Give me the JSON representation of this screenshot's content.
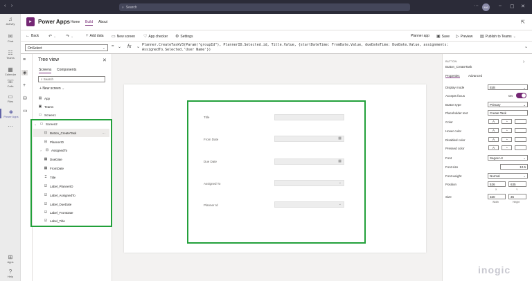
{
  "titlebar": {
    "search_placeholder": "Search",
    "avatar_initials": "MA"
  },
  "rail": [
    {
      "label": "Activity",
      "icon": "bell-icon"
    },
    {
      "label": "Chat",
      "icon": "chat-icon"
    },
    {
      "label": "Teams",
      "icon": "teams-icon"
    },
    {
      "label": "Calendar",
      "icon": "calendar-icon"
    },
    {
      "label": "Calls",
      "icon": "phone-icon"
    },
    {
      "label": "Files",
      "icon": "file-icon"
    },
    {
      "label": "Power Apps",
      "icon": "powerapps-icon"
    },
    {
      "label": "Apps",
      "icon": "apps-icon"
    },
    {
      "label": "Help",
      "icon": "help-icon"
    }
  ],
  "header": {
    "app_name": "Power Apps",
    "tabs": [
      "Home",
      "Build",
      "About"
    ],
    "active_tab": "Build"
  },
  "commands": {
    "back": "Back",
    "add_data": "Add data",
    "new_screen": "New screen",
    "app_checker": "App checker",
    "settings": "Settings",
    "planner_app": "Planner app",
    "save": "Save",
    "preview": "Preview",
    "publish": "Publish to Teams"
  },
  "formula_bar": {
    "property": "OnSelect",
    "fx": "fx",
    "line1": "Planner.CreateTaskV3(Param(\"groupId\"), PlannerID.Selected.id, Title.Value, {startDateTime: FromDate.Value, dueDateTime: DueDate.Value, assignments:",
    "line2": "AssignedTo.Selected.'User Name'})"
  },
  "tree": {
    "title": "Tree view",
    "tabs": [
      "Screens",
      "Components"
    ],
    "search_placeholder": "Search",
    "new_screen": "New screen",
    "nodes": [
      {
        "label": "App",
        "icon": "app-icon"
      },
      {
        "label": "Teams",
        "icon": "teams-icon"
      },
      {
        "label": "Screen1",
        "icon": "screen-icon"
      },
      {
        "label": "Screen2",
        "icon": "screen-icon"
      },
      {
        "label": "Button_CreateTask",
        "icon": "button-icon"
      },
      {
        "label": "PlannerID",
        "icon": "dropdown-icon"
      },
      {
        "label": "AssignedTo",
        "icon": "combobox-icon"
      },
      {
        "label": "DueDate",
        "icon": "date-icon"
      },
      {
        "label": "FromDate",
        "icon": "date-icon"
      },
      {
        "label": "Title",
        "icon": "textinput-icon"
      },
      {
        "label": "Label_PlannerID",
        "icon": "label-icon"
      },
      {
        "label": "Label_AssignedTo",
        "icon": "label-icon"
      },
      {
        "label": "Label_DueDate",
        "icon": "label-icon"
      },
      {
        "label": "Label_FromDate",
        "icon": "label-icon"
      },
      {
        "label": "Label_Title",
        "icon": "label-icon"
      }
    ]
  },
  "form": {
    "fields": [
      {
        "label": "Title",
        "kind": "text"
      },
      {
        "label": "From Date",
        "kind": "date"
      },
      {
        "label": "Due Date",
        "kind": "date"
      },
      {
        "label": "Assigned To",
        "kind": "select"
      },
      {
        "label": "Planner Id",
        "kind": "select"
      }
    ]
  },
  "properties": {
    "type_label": "BUTTON",
    "control_name": "Button_CreateTask",
    "tabs": [
      "Properties",
      "Advanced"
    ],
    "display_mode_label": "Display mode",
    "display_mode": "Edit",
    "accepts_focus_label": "Accepts focus",
    "accepts_focus": "On",
    "button_type_label": "Button type",
    "button_type": "Primary",
    "placeholder_label": "Placeholder text",
    "placeholder": "Create Task",
    "color_label": "Color",
    "hover_label": "Hover color",
    "disabled_label": "Disabled color",
    "pressed_label": "Pressed color",
    "font_label": "Font",
    "font": "Segoe UI",
    "font_size_label": "Font size",
    "font_size": "10.5",
    "font_weight_label": "Font weight",
    "font_weight": "Normal",
    "position_label": "Position",
    "pos_x": "526",
    "pos_y": "635",
    "x_label": "X",
    "y_label": "Y",
    "size_label": "Size",
    "width": "320",
    "height": "35",
    "width_label": "Width",
    "height_label": "Height"
  },
  "watermark": "inogic",
  "colors": {
    "highlight": "#22a03a",
    "brand": "#742774",
    "teams": "#6264a7"
  }
}
